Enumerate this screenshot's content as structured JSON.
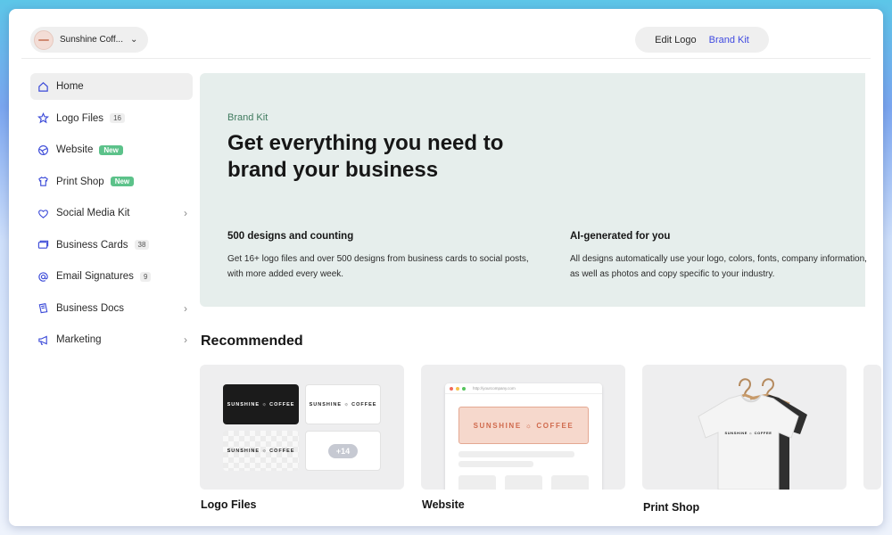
{
  "topbar": {
    "company_name": "Sunshine Coff...",
    "chevron_icon": "chevron-down-icon",
    "edit_logo_label": "Edit Logo",
    "brand_kit_label": "Brand Kit",
    "accent_color": "#3f49e0"
  },
  "sidebar": {
    "items": [
      {
        "label": "Home",
        "icon": "home-icon",
        "active": true
      },
      {
        "label": "Logo Files",
        "icon": "star-icon",
        "count": "16"
      },
      {
        "label": "Website",
        "icon": "globe-icon",
        "badge": "New"
      },
      {
        "label": "Print Shop",
        "icon": "shirt-icon",
        "badge": "New"
      },
      {
        "label": "Social Media Kit",
        "icon": "heart-icon",
        "has_submenu": true
      },
      {
        "label": "Business Cards",
        "icon": "card-icon",
        "count": "38"
      },
      {
        "label": "Email Signatures",
        "icon": "at-icon",
        "count": "9"
      },
      {
        "label": "Business Docs",
        "icon": "document-icon",
        "has_submenu": true
      },
      {
        "label": "Marketing",
        "icon": "megaphone-icon",
        "has_submenu": true
      }
    ]
  },
  "hero": {
    "eyebrow": "Brand Kit",
    "title": "Get everything you need to brand your business",
    "features": [
      {
        "heading": "500 designs and counting",
        "body": "Get 16+ logo files and over 500 designs from business cards to social posts, with more added every week."
      },
      {
        "heading": "AI-generated for you",
        "body": "All designs automatically use your logo, colors, fonts, company information, as well as photos and copy specific to your industry."
      }
    ]
  },
  "recommended": {
    "title": "Recommended",
    "cards": [
      {
        "label": "Logo Files"
      },
      {
        "label": "Website"
      },
      {
        "label": "Print Shop"
      }
    ],
    "logo_text": "SUNSHINE ☼ COFFEE",
    "more_count": "+14",
    "website_url": "http://yourcompany.com"
  }
}
